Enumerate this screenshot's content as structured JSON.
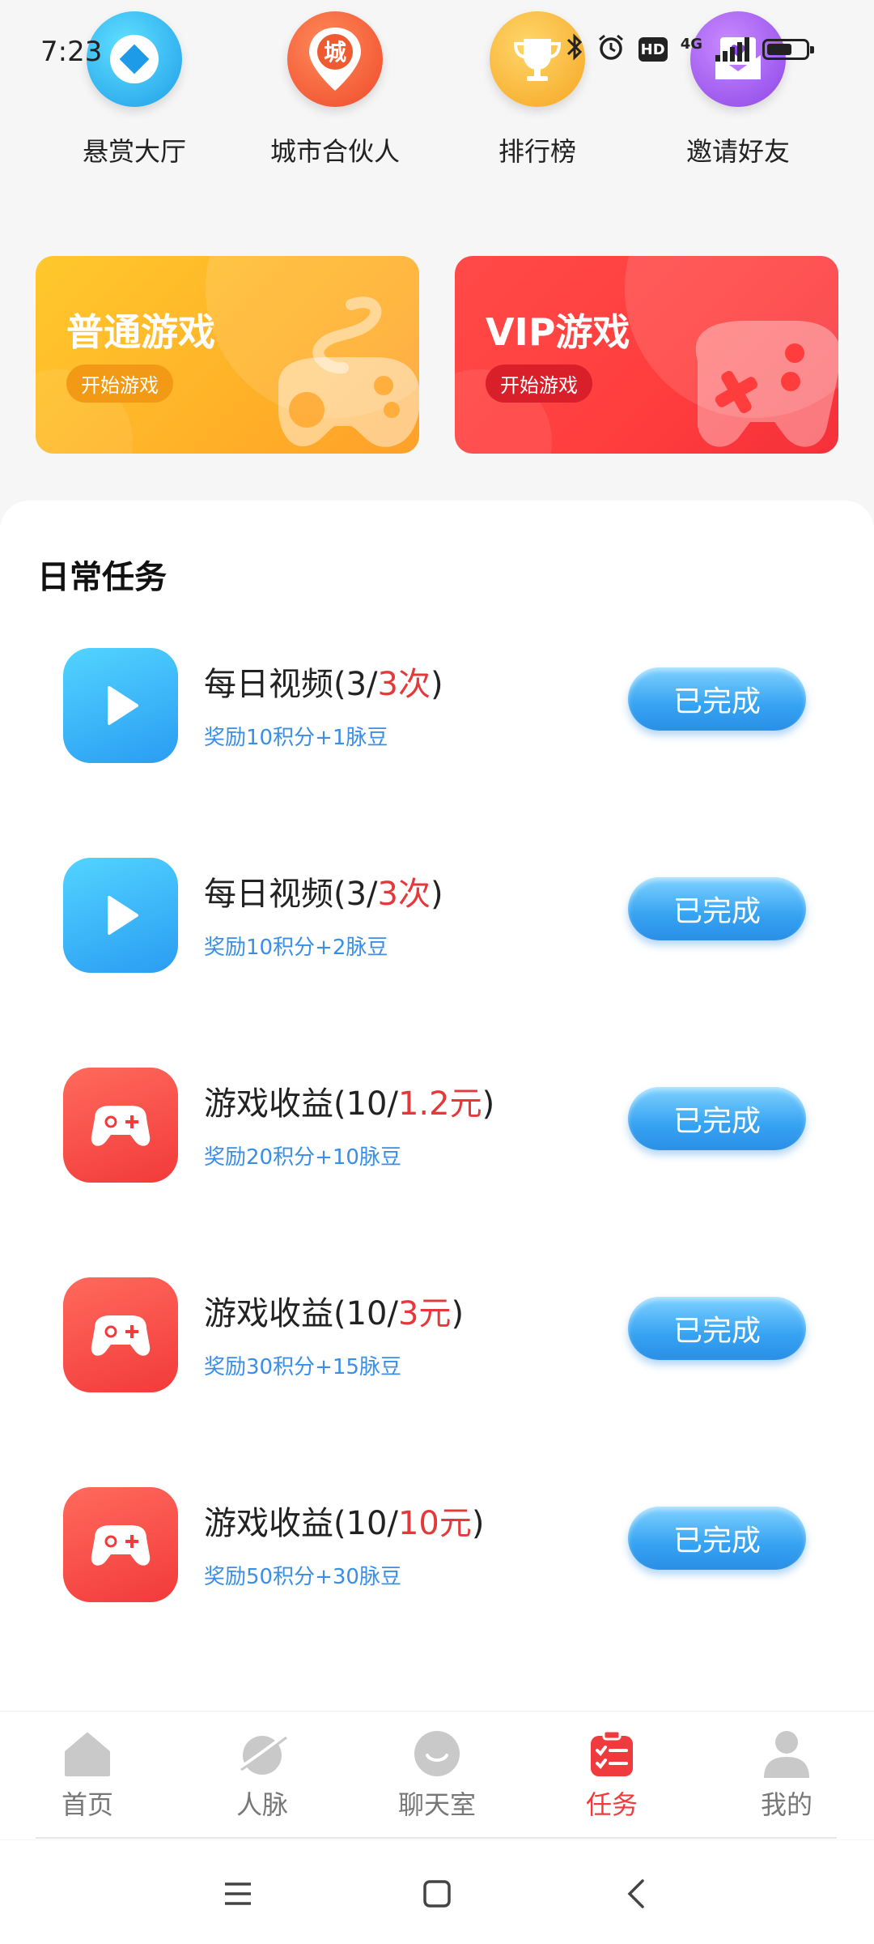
{
  "status_bar": {
    "time": "7:23",
    "hd": "HD",
    "network": "4G"
  },
  "shortcuts": [
    {
      "label": "悬赏大厅",
      "icon": "diamond-icon"
    },
    {
      "label": "城市合伙人",
      "icon": "city-pin-icon",
      "icon_text": "城"
    },
    {
      "label": "排行榜",
      "icon": "trophy-icon"
    },
    {
      "label": "邀请好友",
      "icon": "heart-mail-icon"
    }
  ],
  "banners": [
    {
      "title": "普通游戏",
      "button": "开始游戏"
    },
    {
      "title": "VIP游戏",
      "button": "开始游戏"
    }
  ],
  "daily_tasks": {
    "title": "日常任务",
    "items": [
      {
        "icon": "play-icon",
        "title_prefix": "每日视频(3/",
        "title_highlight": "3次",
        "title_suffix": ")",
        "reward": "奖励10积分+1脉豆",
        "button": "已完成"
      },
      {
        "icon": "play-icon",
        "title_prefix": "每日视频(3/",
        "title_highlight": "3次",
        "title_suffix": ")",
        "reward": "奖励10积分+2脉豆",
        "button": "已完成"
      },
      {
        "icon": "gamepad-icon",
        "title_prefix": "游戏收益(10/",
        "title_highlight": "1.2元",
        "title_suffix": ")",
        "reward": "奖励20积分+10脉豆",
        "button": "已完成"
      },
      {
        "icon": "gamepad-icon",
        "title_prefix": "游戏收益(10/",
        "title_highlight": "3元",
        "title_suffix": ")",
        "reward": "奖励30积分+15脉豆",
        "button": "已完成"
      },
      {
        "icon": "gamepad-icon",
        "title_prefix": "游戏收益(10/",
        "title_highlight": "10元",
        "title_suffix": ")",
        "reward": "奖励50积分+30脉豆",
        "button": "已完成"
      }
    ]
  },
  "tabbar": {
    "active": "任务",
    "tabs": [
      {
        "label": "首页",
        "icon": "home-icon"
      },
      {
        "label": "人脉",
        "icon": "planet-icon"
      },
      {
        "label": "聊天室",
        "icon": "chat-icon"
      },
      {
        "label": "任务",
        "icon": "task-list-icon"
      },
      {
        "label": "我的",
        "icon": "profile-icon"
      }
    ]
  },
  "colors": {
    "accent_red": "#ef3a3e",
    "highlight_red": "#e5383b",
    "reward_blue": "#3a8ee6",
    "done_blue": "#36a3f2"
  }
}
